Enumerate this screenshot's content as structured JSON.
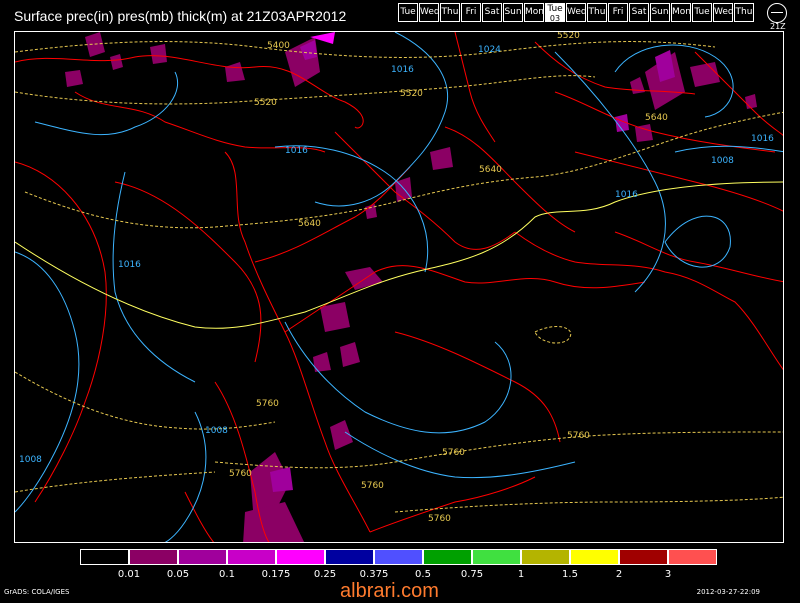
{
  "title": "Surface prec(in) pres(mb) thick(m) at 21Z03APR2012",
  "days": [
    "Tue",
    "Wed",
    "Thu",
    "Fri",
    "Sat",
    "Sun",
    "Mon",
    "Tue",
    "Wed",
    "Thu",
    "Fri",
    "Sat",
    "Sun",
    "Mon",
    "Tue",
    "Wed",
    "Thu"
  ],
  "active_day_index": 7,
  "active_day_date": "03",
  "clock_label": "21Z",
  "contour_labels": {
    "isobars": [
      "1024",
      "1016",
      "1016",
      "1016",
      "1016",
      "1008",
      "1008",
      "1008",
      "1016"
    ],
    "thickness": [
      "5400",
      "5520",
      "5520",
      "5520",
      "5640",
      "5640",
      "5640",
      "5760",
      "5760",
      "5760",
      "5760",
      "5760",
      "5760"
    ]
  },
  "legend": {
    "colors": [
      "#000000",
      "#8b0064",
      "#a0009c",
      "#c800c8",
      "#ff00ff",
      "#0000a0",
      "#5050ff",
      "#00a000",
      "#40e040",
      "#b4b400",
      "#ffff00",
      "#a00000",
      "#ff5050"
    ],
    "labels": [
      "0.01",
      "0.05",
      "0.1",
      "0.175",
      "0.25",
      "0.375",
      "0.5",
      "0.75",
      "1",
      "1.5",
      "2",
      "3"
    ]
  },
  "footer": {
    "left": "GrADS: COLA/IGES",
    "right": "2012-03-27-22:09",
    "watermark": "albrari.com"
  }
}
